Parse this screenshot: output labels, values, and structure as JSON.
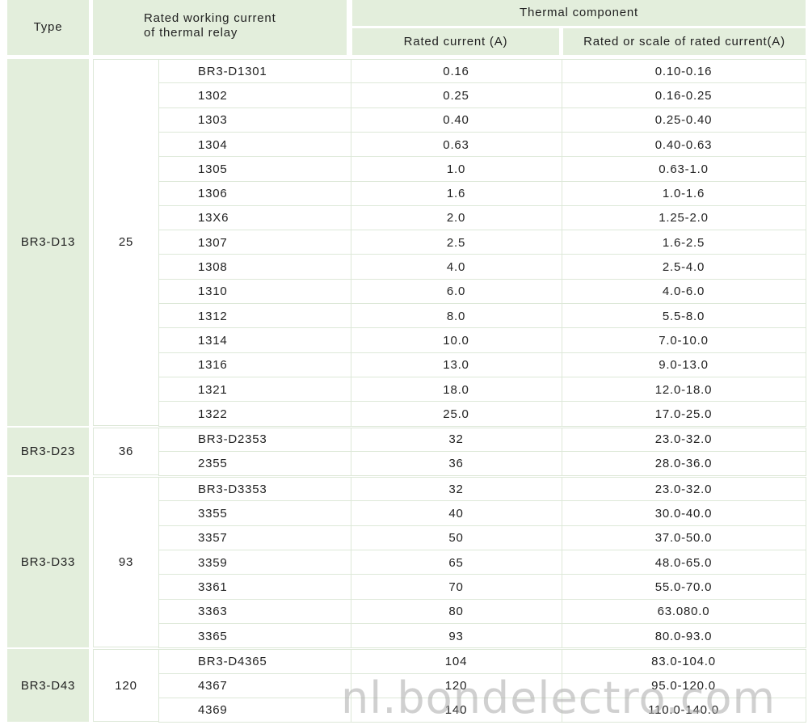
{
  "header": {
    "type": "Type",
    "rated_working_current": "Rated working current\nof thermal relay",
    "thermal_component": "Thermal component",
    "rated_current": "Rated current (A)",
    "rated_scale": "Rated or scale of rated current(A)"
  },
  "groups": [
    {
      "type": "BR3-D13",
      "working_current": "25",
      "rows": [
        {
          "model": "BR3-D1301",
          "rated_current": "0.16",
          "range": "0.10-0.16"
        },
        {
          "model": "1302",
          "rated_current": "0.25",
          "range": "0.16-0.25"
        },
        {
          "model": "1303",
          "rated_current": "0.40",
          "range": "0.25-0.40"
        },
        {
          "model": "1304",
          "rated_current": "0.63",
          "range": "0.40-0.63"
        },
        {
          "model": "1305",
          "rated_current": "1.0",
          "range": "0.63-1.0"
        },
        {
          "model": "1306",
          "rated_current": "1.6",
          "range": "1.0-1.6"
        },
        {
          "model": "13X6",
          "rated_current": "2.0",
          "range": "1.25-2.0"
        },
        {
          "model": "1307",
          "rated_current": "2.5",
          "range": "1.6-2.5"
        },
        {
          "model": "1308",
          "rated_current": "4.0",
          "range": "2.5-4.0"
        },
        {
          "model": "1310",
          "rated_current": "6.0",
          "range": "4.0-6.0"
        },
        {
          "model": "1312",
          "rated_current": "8.0",
          "range": "5.5-8.0"
        },
        {
          "model": "1314",
          "rated_current": "10.0",
          "range": "7.0-10.0"
        },
        {
          "model": "1316",
          "rated_current": "13.0",
          "range": "9.0-13.0"
        },
        {
          "model": "1321",
          "rated_current": "18.0",
          "range": "12.0-18.0"
        },
        {
          "model": "1322",
          "rated_current": "25.0",
          "range": "17.0-25.0"
        }
      ]
    },
    {
      "type": "BR3-D23",
      "working_current": "36",
      "rows": [
        {
          "model": "BR3-D2353",
          "rated_current": "32",
          "range": "23.0-32.0"
        },
        {
          "model": "2355",
          "rated_current": "36",
          "range": "28.0-36.0"
        }
      ]
    },
    {
      "type": "BR3-D33",
      "working_current": "93",
      "rows": [
        {
          "model": "BR3-D3353",
          "rated_current": "32",
          "range": "23.0-32.0"
        },
        {
          "model": "3355",
          "rated_current": "40",
          "range": "30.0-40.0"
        },
        {
          "model": "3357",
          "rated_current": "50",
          "range": "37.0-50.0"
        },
        {
          "model": "3359",
          "rated_current": "65",
          "range": "48.0-65.0"
        },
        {
          "model": "3361",
          "rated_current": "70",
          "range": "55.0-70.0"
        },
        {
          "model": "3363",
          "rated_current": "80",
          "range": "63.080.0"
        },
        {
          "model": "3365",
          "rated_current": "93",
          "range": "80.0-93.0"
        }
      ]
    },
    {
      "type": "BR3-D43",
      "working_current": "120",
      "rows": [
        {
          "model": "BR3-D4365",
          "rated_current": "104",
          "range": "83.0-104.0"
        },
        {
          "model": "4367",
          "rated_current": "120",
          "range": "95.0-120.0"
        },
        {
          "model": "4369",
          "rated_current": "140",
          "range": "110.0-140.0"
        }
      ]
    }
  ],
  "watermark": "nl.bondelectro.com"
}
